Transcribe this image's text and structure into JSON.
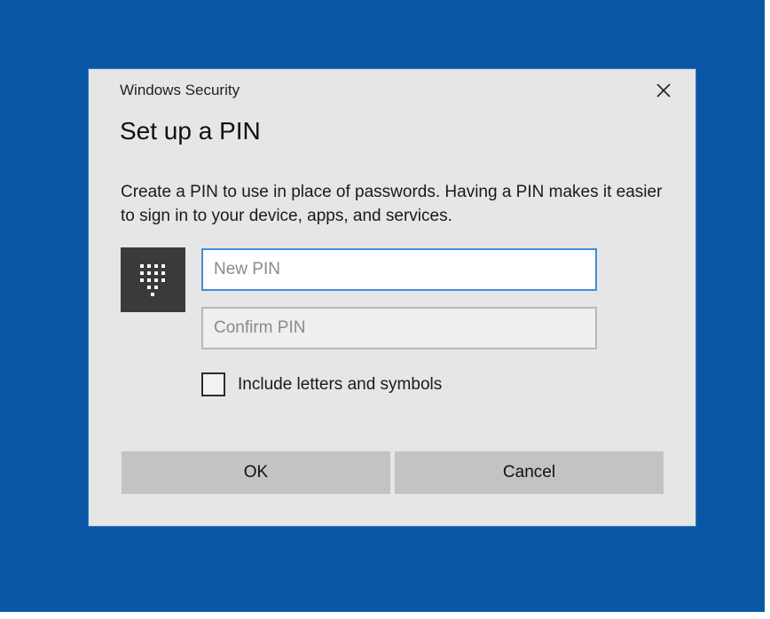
{
  "dialog": {
    "app_title": "Windows Security",
    "heading": "Set up a PIN",
    "description": "Create a PIN to use in place of passwords. Having a PIN makes it easier to sign in to your device, apps, and services.",
    "pin_icon": "keypad-icon",
    "close_icon": "close-icon",
    "new_pin": {
      "placeholder": "New PIN",
      "value": ""
    },
    "confirm_pin": {
      "placeholder": "Confirm PIN",
      "value": ""
    },
    "include_letters": {
      "label": "Include letters and symbols",
      "checked": false
    },
    "buttons": {
      "ok": "OK",
      "cancel": "Cancel"
    }
  },
  "colors": {
    "desktop_background": "#0a58a5",
    "dialog_background": "#e6e6e6",
    "focus_border": "#3f8fd8",
    "button_background": "#c3c3c3",
    "icon_tile": "#3a3a3a"
  }
}
